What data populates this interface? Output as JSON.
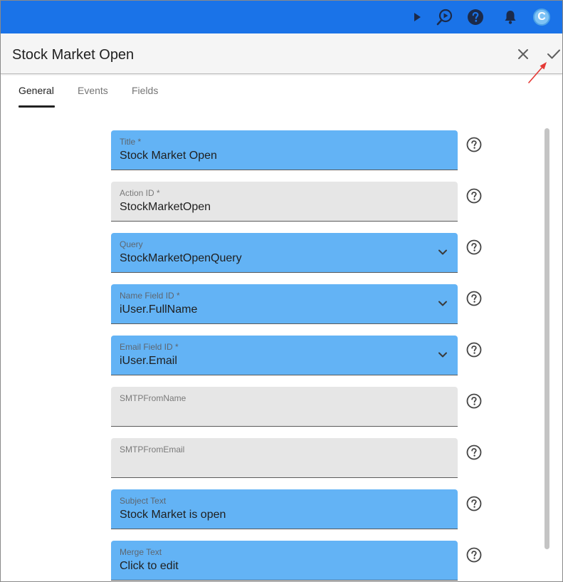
{
  "header": {
    "title": "Stock Market Open",
    "avatar_letter": "C",
    "icons": [
      "play-icon",
      "replay-icon",
      "help-icon",
      "bell-icon",
      "avatar"
    ]
  },
  "tabs": [
    {
      "label": "General",
      "active": true
    },
    {
      "label": "Events",
      "active": false
    },
    {
      "label": "Fields",
      "active": false
    }
  ],
  "fields": [
    {
      "label": "Title *",
      "value": "Stock Market Open",
      "type": "text"
    },
    {
      "label": "Action ID *",
      "value": "StockMarketOpen",
      "type": "text"
    },
    {
      "label": "Query",
      "value": "StockMarketOpenQuery",
      "type": "select"
    },
    {
      "label": "Name Field ID *",
      "value": "iUser.FullName",
      "type": "select"
    },
    {
      "label": "Email Field ID *",
      "value": "iUser.Email",
      "type": "select"
    },
    {
      "label": "SMTPFromName",
      "value": "",
      "type": "text"
    },
    {
      "label": "SMTPFromEmail",
      "value": "",
      "type": "text"
    },
    {
      "label": "Subject Text",
      "value": "Stock Market is open",
      "type": "text"
    },
    {
      "label": "Merge Text",
      "value": "Click to edit",
      "type": "text"
    }
  ],
  "colors": {
    "topbar": "#1a73e8",
    "field_active": "#63b3f5",
    "field_inactive": "#e6e6e6",
    "annotation_arrow": "#e53935"
  }
}
